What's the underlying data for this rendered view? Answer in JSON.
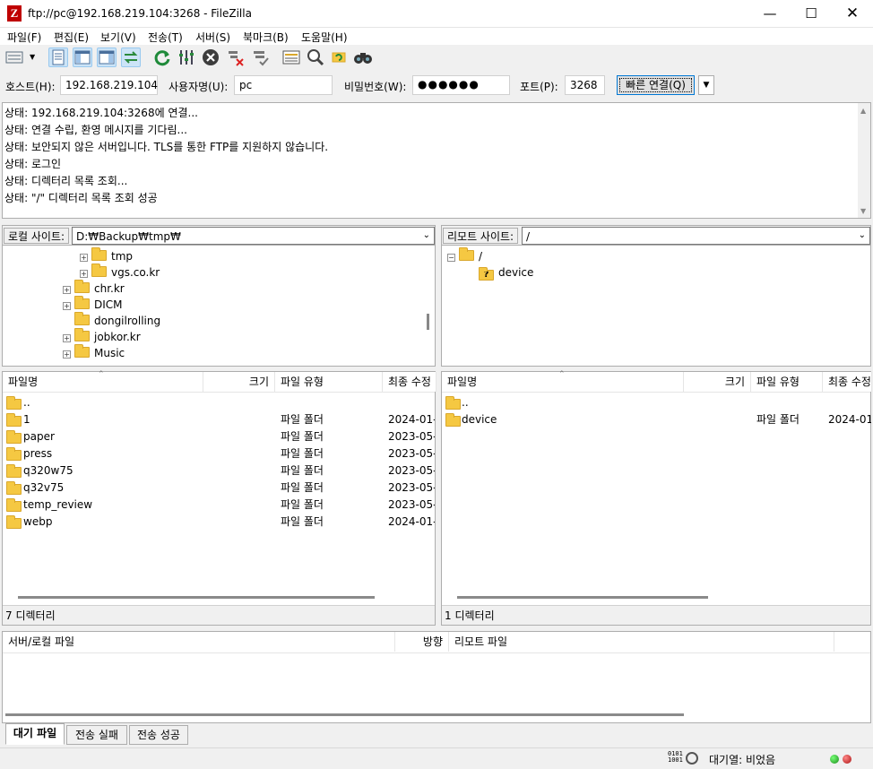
{
  "window": {
    "title": "ftp://pc@192.168.219.104:3268 - FileZilla",
    "app_icon_letter": "Z"
  },
  "menu": [
    "파일(F)",
    "편집(E)",
    "보기(V)",
    "전송(T)",
    "서버(S)",
    "북마크(B)",
    "도움말(H)"
  ],
  "quickconnect": {
    "host_label": "호스트(H):",
    "host_value": "192.168.219.104",
    "user_label": "사용자명(U):",
    "user_value": "pc",
    "pass_label": "비밀번호(W):",
    "pass_value": "●●●●●●",
    "port_label": "포트(P):",
    "port_value": "3268",
    "connect_label": "빠른 연결(Q)"
  },
  "log": [
    "상태:\t192.168.219.104:3268에 연결...",
    "상태:\t연결 수립, 환영 메시지를 기다림...",
    "상태:\t보안되지 않은 서버입니다. TLS를 통한 FTP를 지원하지 않습니다.",
    "상태:\t로그인",
    "상태:\t디렉터리 목록 조회...",
    "상태:\t\"/\" 디렉터리 목록 조회 성공"
  ],
  "local": {
    "site_label": "로컬 사이트:",
    "path": "D:₩Backup₩tmp₩",
    "tree": [
      {
        "label": "tmp",
        "indent": 2,
        "expander": "+"
      },
      {
        "label": "vgs.co.kr",
        "indent": 2,
        "expander": "+"
      },
      {
        "label": "chr.kr",
        "indent": 1,
        "expander": "+"
      },
      {
        "label": "DICM",
        "indent": 1,
        "expander": "+"
      },
      {
        "label": "dongilrolling",
        "indent": 1,
        "expander": ""
      },
      {
        "label": "jobkor.kr",
        "indent": 1,
        "expander": "+"
      },
      {
        "label": "Music",
        "indent": 1,
        "expander": "+"
      }
    ],
    "columns": [
      "파일명",
      "크기",
      "파일 유형",
      "최종 수정"
    ],
    "files": [
      {
        "name": "..",
        "size": "",
        "type": "",
        "modified": ""
      },
      {
        "name": "1",
        "size": "",
        "type": "파일 폴더",
        "modified": "2024-01-"
      },
      {
        "name": "paper",
        "size": "",
        "type": "파일 폴더",
        "modified": "2023-05-"
      },
      {
        "name": "press",
        "size": "",
        "type": "파일 폴더",
        "modified": "2023-05-"
      },
      {
        "name": "q320w75",
        "size": "",
        "type": "파일 폴더",
        "modified": "2023-05-"
      },
      {
        "name": "q32v75",
        "size": "",
        "type": "파일 폴더",
        "modified": "2023-05-"
      },
      {
        "name": "temp_review",
        "size": "",
        "type": "파일 폴더",
        "modified": "2023-05-"
      },
      {
        "name": "webp",
        "size": "",
        "type": "파일 폴더",
        "modified": "2024-01-"
      }
    ],
    "status": "7 디렉터리"
  },
  "remote": {
    "site_label": "리모트 사이트:",
    "path": "/",
    "tree": [
      {
        "label": "/",
        "indent": 0,
        "expander": "−"
      },
      {
        "label": "device",
        "indent": 1,
        "expander": ""
      }
    ],
    "columns": [
      "파일명",
      "크기",
      "파일 유형",
      "최종 수정"
    ],
    "files": [
      {
        "name": "..",
        "size": "",
        "type": "",
        "modified": ""
      },
      {
        "name": "device",
        "size": "",
        "type": "파일 폴더",
        "modified": "2024-01"
      }
    ],
    "status": "1 디렉터리"
  },
  "queue": {
    "columns": [
      "서버/로컬 파일",
      "방향",
      "리모트 파일"
    ],
    "tabs": [
      "대기 파일",
      "전송 실패",
      "전송 성공"
    ]
  },
  "statusbar": {
    "queue_text": "대기열: 비었음"
  }
}
